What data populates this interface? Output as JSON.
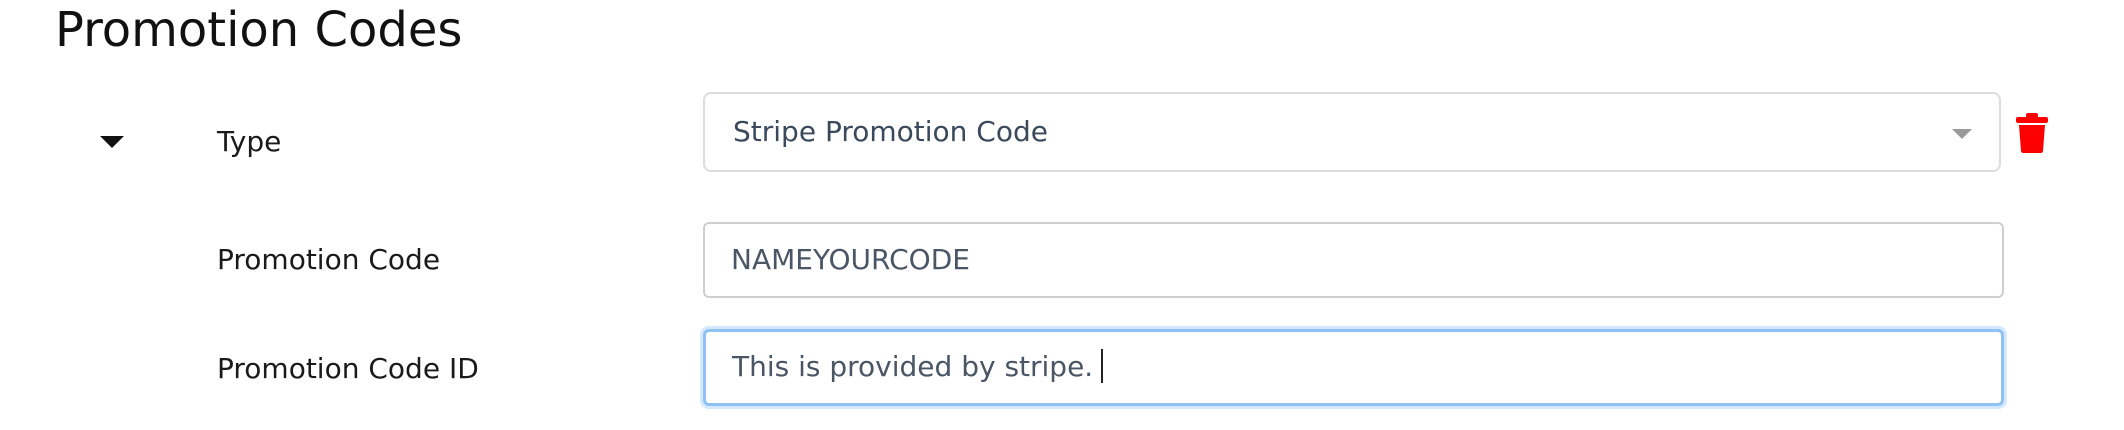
{
  "page": {
    "title": "Promotion Codes"
  },
  "promotion_code_entry": {
    "expanded": true,
    "type": {
      "label": "Type",
      "selected_value": "Stripe Promotion Code"
    },
    "promotion_code": {
      "label": "Promotion Code",
      "value": "NAMEYOURCODE"
    },
    "promotion_code_id": {
      "label": "Promotion Code ID",
      "value": "This is provided by stripe.",
      "focused": true
    }
  },
  "icons": {
    "collapse_toggle": "caret-down-icon",
    "select_caret": "chevron-down-icon",
    "delete": "trash-icon"
  },
  "colors": {
    "delete_icon": "#ff0000",
    "focus_ring": "#8fc1f2",
    "input_border": "#cfcfcf",
    "input_text": "#4a5666"
  }
}
